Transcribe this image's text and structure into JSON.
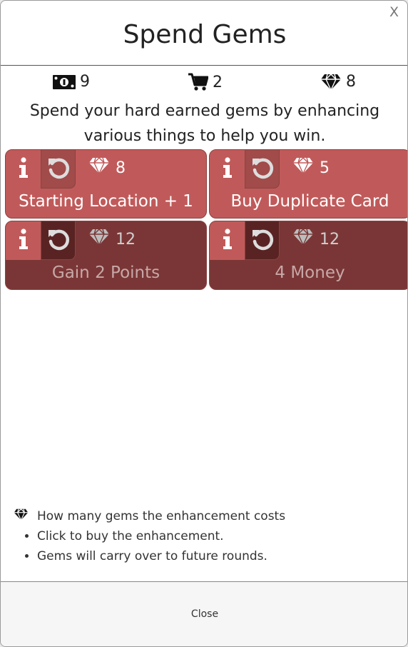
{
  "dialog": {
    "title": "Spend Gems",
    "close_x": "X",
    "close_button": "Close"
  },
  "stats": {
    "money": "9",
    "cart": "2",
    "gems": "8"
  },
  "description": "Spend your hard earned gems by enhancing various things to help you win.",
  "enhancements": [
    {
      "label": "Starting Location + 1",
      "cost": "8",
      "state": "active"
    },
    {
      "label": "Buy Duplicate Card",
      "cost": "5",
      "state": "active"
    },
    {
      "label": "Gain 2 Points",
      "cost": "12",
      "state": "inactive"
    },
    {
      "label": "4 Money",
      "cost": "12",
      "state": "inactive"
    }
  ],
  "legend": {
    "gem_text": "How many gems the enhancement costs",
    "items": [
      "Click to buy the enhancement.",
      "Gems will carry over to future rounds."
    ]
  },
  "colors": {
    "card_active": "#c05a5a",
    "card_inactive": "#7a3636",
    "undo_active": "#a14b4b",
    "undo_inactive": "#5a2323"
  },
  "icons": {
    "money": "money-bill-icon",
    "cart": "shopping-cart-icon",
    "gem": "gem-icon",
    "info": "info-icon",
    "undo": "undo-icon"
  }
}
